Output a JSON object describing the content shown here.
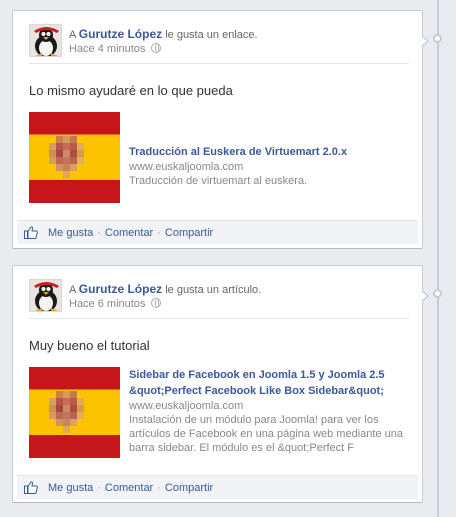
{
  "posts": [
    {
      "prefix": "A",
      "author": "Gurutze López",
      "verb": "le gusta un enlace.",
      "time": "Hace 4 minutos",
      "message": "Lo mismo ayudaré en lo que pueda",
      "attachment": {
        "title": "Traducción al Euskera de Virtuemart 2.0.x",
        "url": "www.euskaljoomla.com",
        "description": "Traducción de virtuemart al euskera."
      },
      "actions": {
        "like": "Me gusta",
        "comment": "Comentar",
        "share": "Compartir"
      }
    },
    {
      "prefix": "A",
      "author": "Gurutze López",
      "verb": "le gusta un artículo.",
      "time": "Hace 6 minutos",
      "message": "Muy bueno el tutorial",
      "attachment": {
        "title": "Sidebar de Facebook en Joomla 1.5 y Joomla 2.5 &quot;Perfect Facebook Like Box Sidebar&quot;",
        "url": "www.euskaljoomla.com",
        "description": "Instalación de un módulo para Joomla! para ver los artículos de Facebook en una página web mediante una barra sidebar. El módulo es el &quot;Perfect F"
      },
      "actions": {
        "like": "Me gusta",
        "comment": "Comentar",
        "share": "Compartir"
      }
    }
  ],
  "colors": {
    "link": "#3b5998",
    "flag_red": "#c6161c",
    "flag_yellow": "#fcc400"
  }
}
